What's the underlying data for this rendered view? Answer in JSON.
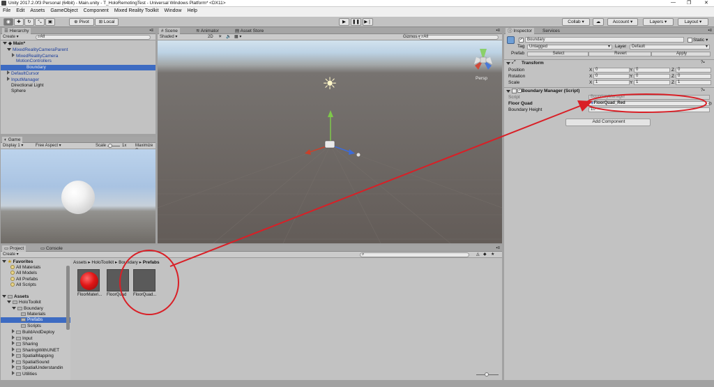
{
  "window": {
    "title": "Unity 2017.2.0f3 Personal (64bit) - Main.unity - T_HoloRemotingTest - Universal Windows Platform* <DX11>",
    "min": "—",
    "max": "❐",
    "close": "✕"
  },
  "menu": [
    "File",
    "Edit",
    "Assets",
    "GameObject",
    "Component",
    "Mixed Reality Toolkit",
    "Window",
    "Help"
  ],
  "toolbar": {
    "pivot": "Pivot",
    "local": "Local",
    "collab": "Collab ▾",
    "account": "Account ▾",
    "layers": "Layers",
    "layout": "Layout",
    "cloud": "☁"
  },
  "hierarchy": {
    "tab": "Hierarchy",
    "create": "Create ▾",
    "search": "All",
    "items": [
      "Main*",
      "MixedRealityCameraParent",
      "MixedRealityCamera",
      "MotionControllers",
      "Boundary",
      "DefaultCursor",
      "InputManager",
      "Directional Light",
      "Sphere"
    ]
  },
  "scene": {
    "tabs": [
      "Scene",
      "Animator",
      "Asset Store"
    ],
    "shaded": "Shaded",
    "mode2d": "2D",
    "gizmos": "Gizmos ▾",
    "search": "All",
    "persp": "Persp"
  },
  "game": {
    "tab": "Game",
    "display": "Display 1",
    "aspect": "Free Aspect",
    "scale": "Scale",
    "scale_value": "1x",
    "maximize": "Maximize C"
  },
  "project": {
    "tabs": [
      "Project",
      "Console"
    ],
    "create": "Create ▾",
    "breadcrumb": [
      "Assets",
      "HoloToolkit",
      "Boundary",
      "Prefabs"
    ],
    "favorites_header": "Favorites",
    "favorites": [
      "All Materials",
      "All Models",
      "All Prefabs",
      "All Scripts"
    ],
    "assets_header": "Assets",
    "tree": [
      "HoloToolkit",
      "Boundary",
      "Materials",
      "Prefabs",
      "Scripts",
      "BuildAndDeploy",
      "Input",
      "Sharing",
      "SharingWithUNET",
      "SpatialMapping",
      "SpatialSound",
      "SpatialUnderstandin",
      "Utilities"
    ],
    "assets": [
      "FloorMateri...",
      "FloorQuad",
      "FloorQuad..."
    ]
  },
  "inspector": {
    "tabs": [
      "Inspector",
      "Services"
    ],
    "object_name": "Boundary",
    "static": "Static",
    "tag_label": "Tag",
    "tag": "Untagged",
    "layer_label": "Layer",
    "layer": "Default",
    "prefab_label": "Prefab",
    "prefab_buttons": [
      "Select",
      "Revert",
      "Apply"
    ],
    "transform": {
      "title": "Transform",
      "rows": [
        {
          "label": "Position",
          "x": "0",
          "y": "0",
          "z": "0"
        },
        {
          "label": "Rotation",
          "x": "0",
          "y": "0",
          "z": "0"
        },
        {
          "label": "Scale",
          "x": "1",
          "y": "1",
          "z": "1"
        }
      ]
    },
    "boundary_manager": {
      "title": "Boundary Manager (Script)",
      "script_label": "Script",
      "script": "BoundaryManager",
      "floor_quad_label": "Floor Quad",
      "floor_quad": "FloorQuad_Red",
      "height_label": "Boundary Height",
      "height": "10"
    },
    "add_component": "Add Component"
  },
  "colors": {
    "annotation": "#d91f26",
    "selection": "#3d6bc2",
    "prefab_text": "#1a3d9c"
  }
}
